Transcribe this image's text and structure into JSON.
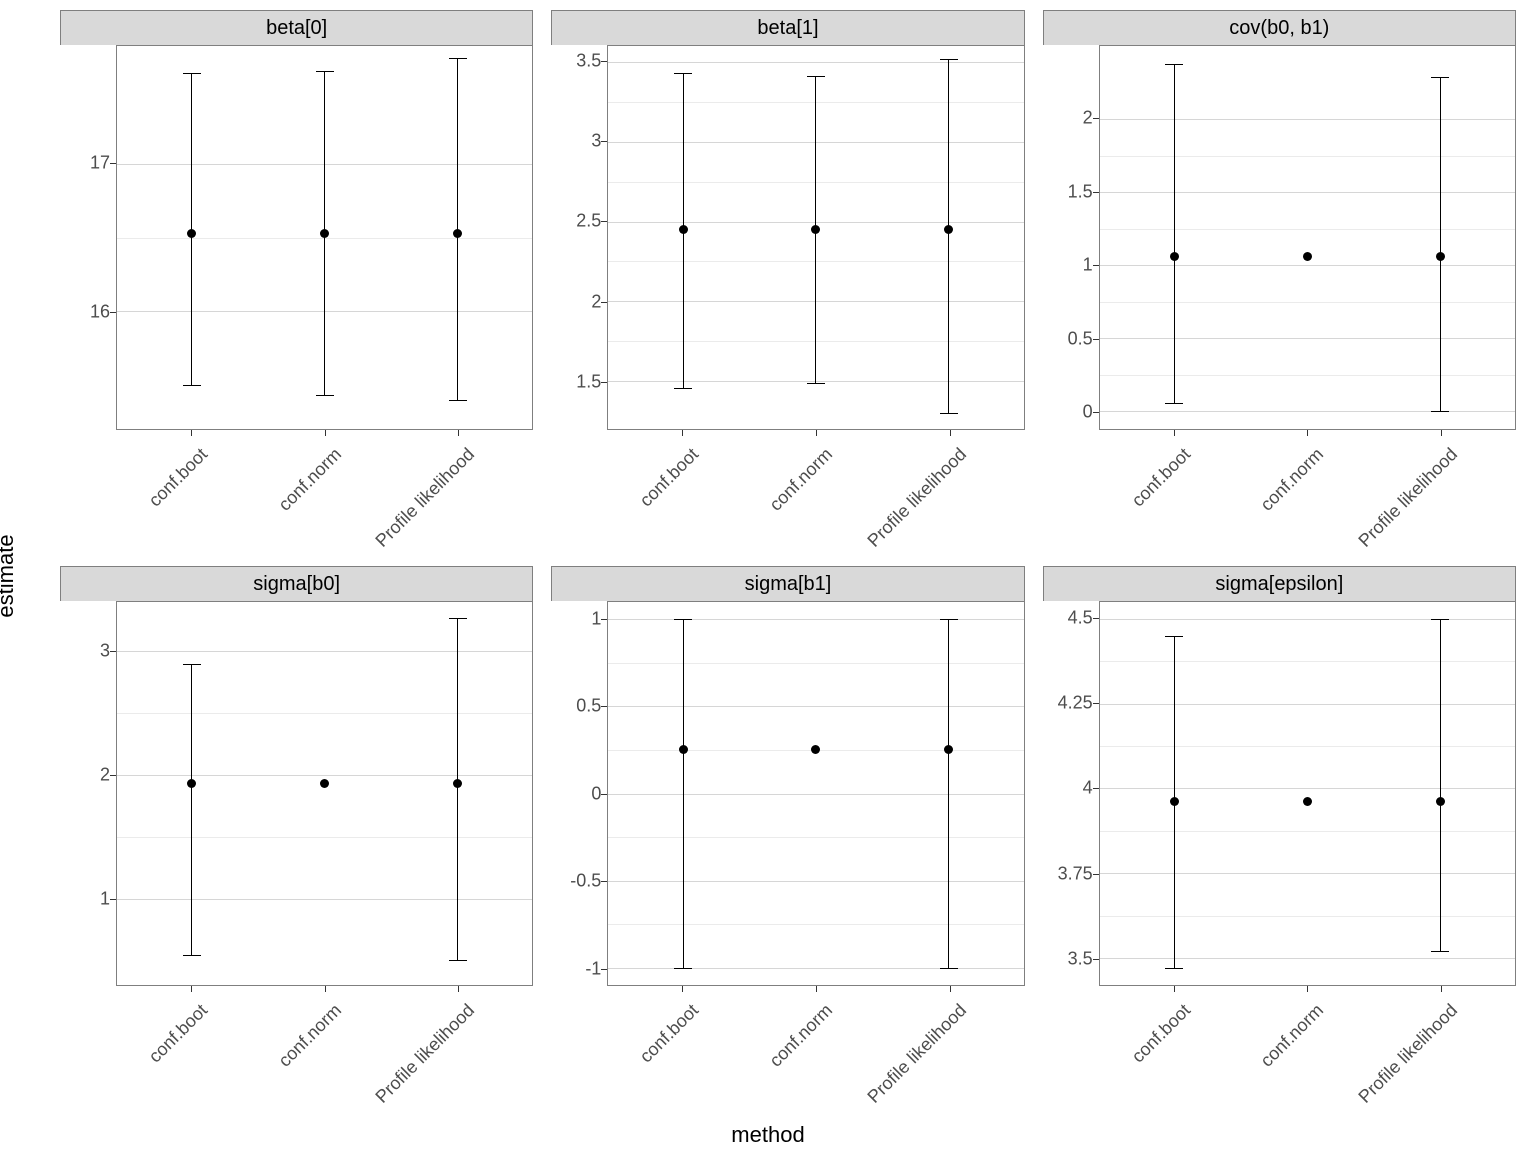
{
  "xlabel": "method",
  "ylabel": "estimate",
  "methods": [
    "conf.boot",
    "conf.norm",
    "Profile likelihood"
  ],
  "chart_data": [
    {
      "title": "beta[0]",
      "ylim": [
        15.2,
        17.8
      ],
      "yticks": [
        16,
        17
      ],
      "series": [
        {
          "name": "conf.boot",
          "est": 16.53,
          "lo": 15.5,
          "hi": 17.62
        },
        {
          "name": "conf.norm",
          "est": 16.53,
          "lo": 15.43,
          "hi": 17.63
        },
        {
          "name": "Profile likelihood",
          "est": 16.53,
          "lo": 15.4,
          "hi": 17.72
        }
      ]
    },
    {
      "title": "beta[1]",
      "ylim": [
        1.2,
        3.6
      ],
      "yticks": [
        1.5,
        2.0,
        2.5,
        3.0,
        3.5
      ],
      "series": [
        {
          "name": "conf.boot",
          "est": 2.45,
          "lo": 1.46,
          "hi": 3.43
        },
        {
          "name": "conf.norm",
          "est": 2.45,
          "lo": 1.49,
          "hi": 3.41
        },
        {
          "name": "Profile likelihood",
          "est": 2.45,
          "lo": 1.3,
          "hi": 3.52
        }
      ]
    },
    {
      "title": "cov(b0, b1)",
      "ylim": [
        -0.12,
        2.5
      ],
      "yticks": [
        0.0,
        0.5,
        1.0,
        1.5,
        2.0
      ],
      "series": [
        {
          "name": "conf.boot",
          "est": 1.06,
          "lo": 0.06,
          "hi": 2.38
        },
        {
          "name": "conf.norm",
          "est": 1.06,
          "lo": null,
          "hi": null
        },
        {
          "name": "Profile likelihood",
          "est": 1.06,
          "lo": 0.0,
          "hi": 2.29
        }
      ]
    },
    {
      "title": "sigma[b0]",
      "ylim": [
        0.3,
        3.4
      ],
      "yticks": [
        1,
        2,
        3
      ],
      "series": [
        {
          "name": "conf.boot",
          "est": 1.93,
          "lo": 0.54,
          "hi": 2.9
        },
        {
          "name": "conf.norm",
          "est": 1.93,
          "lo": null,
          "hi": null
        },
        {
          "name": "Profile likelihood",
          "est": 1.93,
          "lo": 0.5,
          "hi": 3.27
        }
      ]
    },
    {
      "title": "sigma[b1]",
      "ylim": [
        -1.1,
        1.1
      ],
      "yticks": [
        -1.0,
        -0.5,
        0.0,
        0.5,
        1.0
      ],
      "series": [
        {
          "name": "conf.boot",
          "est": 0.25,
          "lo": -1.0,
          "hi": 1.0
        },
        {
          "name": "conf.norm",
          "est": 0.25,
          "lo": null,
          "hi": null
        },
        {
          "name": "Profile likelihood",
          "est": 0.25,
          "lo": -1.0,
          "hi": 1.0
        }
      ]
    },
    {
      "title": "sigma[epsilon]",
      "ylim": [
        3.42,
        4.55
      ],
      "yticks": [
        3.5,
        3.75,
        4.0,
        4.25,
        4.5
      ],
      "series": [
        {
          "name": "conf.boot",
          "est": 3.96,
          "lo": 3.47,
          "hi": 4.45
        },
        {
          "name": "conf.norm",
          "est": 3.96,
          "lo": null,
          "hi": null
        },
        {
          "name": "Profile likelihood",
          "est": 3.96,
          "lo": 3.52,
          "hi": 4.5
        }
      ]
    }
  ]
}
